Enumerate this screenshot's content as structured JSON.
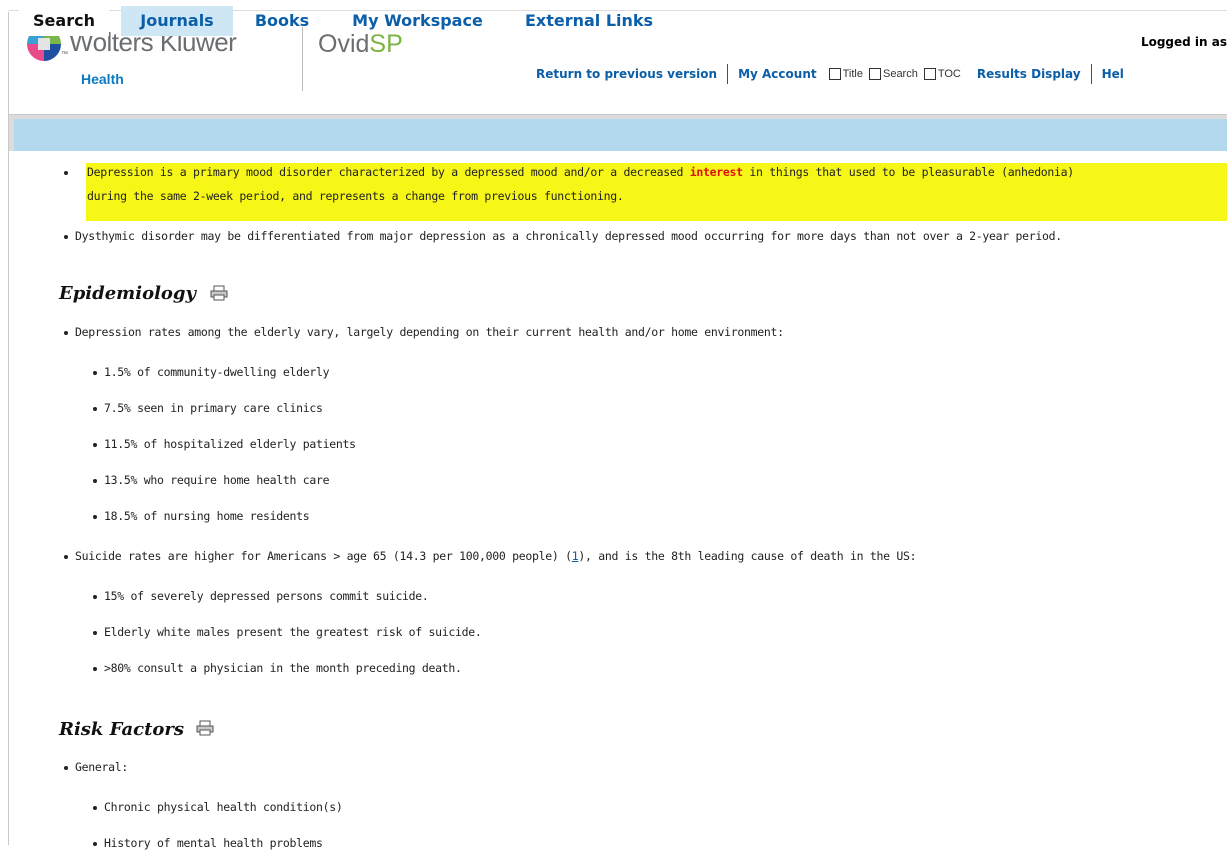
{
  "header": {
    "brand": "Wolters Kluwer",
    "brand_tm": "™",
    "brand_sub": "Health",
    "product_prefix": "Ovid",
    "product_suffix": "SP",
    "logged_in": "Logged in as",
    "links": {
      "previous_version": "Return to previous version",
      "my_account": "My Account",
      "results_display": "Results Display",
      "help": "Hel"
    },
    "checkboxes": [
      "Title",
      "Search",
      "TOC"
    ]
  },
  "tabs": [
    "Search",
    "Journals",
    "Books",
    "My Workspace",
    "External Links"
  ],
  "active_tab": "Search",
  "content": {
    "intro": {
      "b1_part1": "Depression is a primary mood disorder characterized by a depressed mood and/or a decreased ",
      "b1_highlight": "interest",
      "b1_part2": " in things that used to be pleasurable (anhedonia)",
      "b1_line2": "during the same 2-week period, and represents a change from previous functioning.",
      "b2": "Dysthymic disorder may be differentiated from major depression as a chronically depressed mood occurring for more days than not over a 2-year period."
    },
    "epidemiology": {
      "heading": "Epidemiology",
      "b1": "Depression rates among the elderly vary, largely depending on their current health and/or home environment:",
      "rates": [
        "1.5% of community-dwelling elderly",
        "7.5% seen in primary care clinics",
        "11.5% of hospitalized elderly patients",
        "13.5% who require home health care",
        "18.5% of nursing home residents"
      ],
      "b2_part1": "Suicide rates are higher for Americans > age 65 (14.3 per 100,000 people) (",
      "b2_ref": "1",
      "b2_part2": "), and is the 8th leading cause of death in the US:",
      "suicide": [
        "15% of severely depressed persons commit suicide.",
        "Elderly white males present the greatest risk of suicide.",
        ">80% consult a physician in the month preceding death."
      ]
    },
    "risk": {
      "heading": "Risk Factors",
      "b1": "General:",
      "items": [
        "Chronic physical health condition(s)",
        "History of mental health problems"
      ]
    }
  },
  "colors": {
    "link": "#0b5ea8",
    "highlight": "#f7f717",
    "tabbar": "#b4d8ee",
    "green": "#7cb342",
    "red": "#e01010"
  }
}
